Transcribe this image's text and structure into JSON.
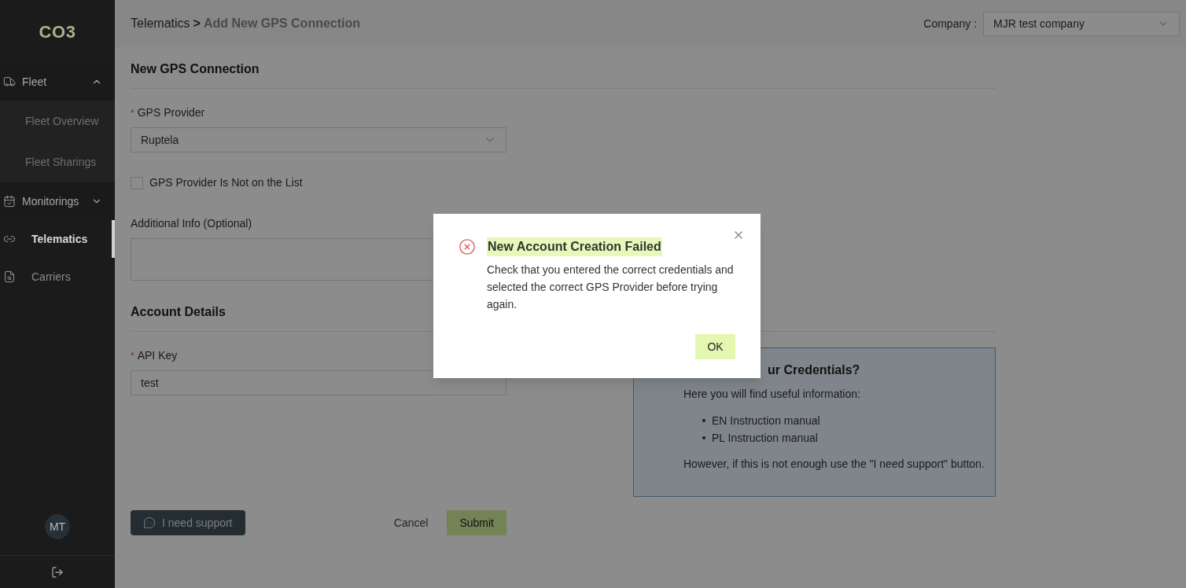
{
  "sidebar": {
    "logo": "CO3",
    "items": [
      {
        "kind": "group",
        "label": "Fleet",
        "expanded": true,
        "selected": false,
        "children": [
          {
            "label": "Fleet Overview",
            "selected": false
          },
          {
            "label": "Fleet Sharings",
            "selected": false
          }
        ]
      },
      {
        "kind": "group",
        "label": "Monitorings",
        "expanded": false,
        "selected": false
      },
      {
        "kind": "link",
        "label": "Telematics",
        "selected": true
      },
      {
        "kind": "link",
        "label": "Carriers",
        "selected": false
      }
    ],
    "avatar": "MT"
  },
  "header": {
    "breadcrumb": {
      "parent": "Telematics",
      "separator": ">",
      "current": "Add New GPS Connection"
    },
    "company_label": "Company :",
    "company_value": "MJR test company"
  },
  "form": {
    "title": "New GPS Connection",
    "gps_provider": {
      "label": "GPS Provider",
      "required_mark": "*",
      "value": "Ruptela"
    },
    "checkbox": {
      "label": "GPS Provider Is Not on the List",
      "checked": false
    },
    "additional_info": {
      "label": "Additional Info (Optional)"
    },
    "account_title": "Account Details",
    "api_key": {
      "label": "API Key",
      "required_mark": "*",
      "value": "test"
    },
    "help": {
      "title": "ur Credentials?",
      "intro": "Here you will find useful information:",
      "links": [
        "EN Instruction manual",
        "PL Instruction manual"
      ],
      "note": "However, if this is not enough use the \"I need support\" button."
    },
    "support_button": "I need support",
    "cancel": "Cancel",
    "submit": "Submit"
  },
  "modal": {
    "title": "New Account Creation Failed",
    "message": "Check that you entered the correct credentials and selected the correct GPS Provider before trying again.",
    "ok": "OK"
  }
}
